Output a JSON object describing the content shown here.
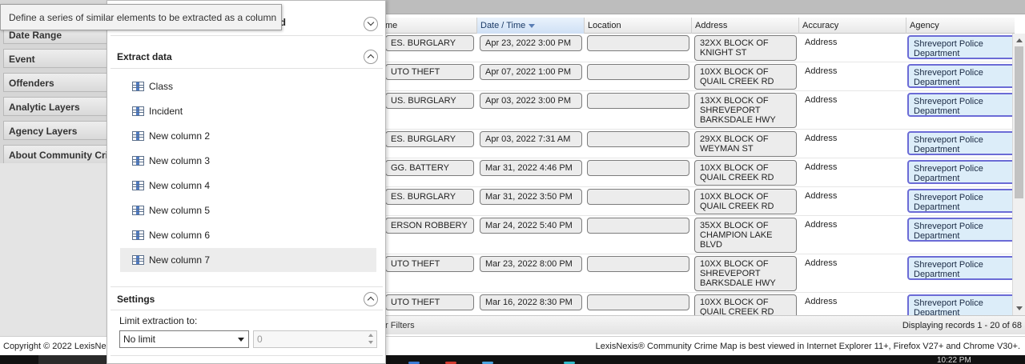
{
  "sidebar": {
    "items": [
      "Date Range",
      "Event",
      "Offenders",
      "Analytic Layers",
      "Agency Layers",
      "About Community Crime"
    ]
  },
  "grid": {
    "columns": [
      {
        "label": "me",
        "sorted": false
      },
      {
        "label": "Date / Time",
        "sorted": true
      },
      {
        "label": "Location",
        "sorted": false
      },
      {
        "label": "Address",
        "sorted": false
      },
      {
        "label": "Accuracy",
        "sorted": false
      },
      {
        "label": "Agency",
        "sorted": false
      }
    ],
    "rows": [
      {
        "crime": "ES. BURGLARY",
        "datetime": "Apr 23, 2022 3:00 PM",
        "location": "",
        "address": [
          "32XX BLOCK OF",
          "KNIGHT ST"
        ],
        "accuracy": "Address",
        "agency": [
          "Shreveport Police",
          "Department"
        ]
      },
      {
        "crime": "UTO THEFT",
        "datetime": "Apr 07, 2022 1:00 PM",
        "location": "",
        "address": [
          "10XX BLOCK OF",
          "QUAIL CREEK RD"
        ],
        "accuracy": "Address",
        "agency": [
          "Shreveport Police",
          "Department"
        ]
      },
      {
        "crime": "US. BURGLARY",
        "datetime": "Apr 03, 2022 3:00 PM",
        "location": "",
        "address": [
          "13XX BLOCK OF",
          "SHREVEPORT",
          "BARKSDALE HWY"
        ],
        "accuracy": "Address",
        "agency": [
          "Shreveport Police",
          "Department"
        ]
      },
      {
        "crime": "ES. BURGLARY",
        "datetime": "Apr 03, 2022 7:31 AM",
        "location": "",
        "address": [
          "29XX BLOCK OF",
          "WEYMAN ST"
        ],
        "accuracy": "Address",
        "agency": [
          "Shreveport Police",
          "Department"
        ]
      },
      {
        "crime": "GG. BATTERY",
        "datetime": "Mar 31, 2022 4:46 PM",
        "location": "",
        "address": [
          "10XX BLOCK OF",
          "QUAIL CREEK RD"
        ],
        "accuracy": "Address",
        "agency": [
          "Shreveport Police",
          "Department"
        ]
      },
      {
        "crime": "ES. BURGLARY",
        "datetime": "Mar 31, 2022 3:50 PM",
        "location": "",
        "address": [
          "10XX BLOCK OF",
          "QUAIL CREEK RD"
        ],
        "accuracy": "Address",
        "agency": [
          "Shreveport Police",
          "Department"
        ]
      },
      {
        "crime": "ERSON ROBBERY",
        "datetime": "Mar 24, 2022 5:40 PM",
        "location": "",
        "address": [
          "35XX BLOCK OF",
          "CHAMPION LAKE",
          "BLVD"
        ],
        "accuracy": "Address",
        "agency": [
          "Shreveport Police",
          "Department"
        ]
      },
      {
        "crime": "UTO THEFT",
        "datetime": "Mar 23, 2022 8:00 PM",
        "location": "",
        "address": [
          "10XX BLOCK OF",
          "SHREVEPORT",
          "BARKSDALE HWY"
        ],
        "accuracy": "Address",
        "agency": [
          "Shreveport Police",
          "Department"
        ]
      },
      {
        "crime": "UTO THEFT",
        "datetime": "Mar 16, 2022 8:30 PM",
        "location": "",
        "address": [
          "10XX BLOCK OF",
          "QUAIL CREEK RD"
        ],
        "accuracy": "Address",
        "agency": [
          "Shreveport Police",
          "Department"
        ]
      }
    ],
    "footer": {
      "filters_label": "r Filters",
      "records_label": "Displaying records 1 - 20 of 68"
    }
  },
  "page_footer": {
    "copyright": "Copyright © 2022 LexisNe",
    "best_viewed": "LexisNexis® Community Crime Map is best viewed in Internet Explorer 11+, Firefox V27+ and Chrome V30+."
  },
  "taskbar": {
    "time": "10:22 PM"
  },
  "panel": {
    "top_section_title_fragment": "ed",
    "extract_section_title": "Extract data",
    "columns": [
      "Class",
      "Incident",
      "New column 2",
      "New column 3",
      "New column 4",
      "New column 5",
      "New column 6",
      "New column 7"
    ],
    "selected_column": "New column 7",
    "settings_title": "Settings",
    "limit_label": "Limit extraction to:",
    "limit_select_value": "No limit",
    "limit_number_value": "0"
  },
  "tooltip": {
    "text": "Define a series of similar elements to be extracted as a column"
  },
  "colors": {
    "agency_border": "#6b6bd6",
    "agency_fill": "#dcedf9",
    "selected_item": "#ececec"
  }
}
